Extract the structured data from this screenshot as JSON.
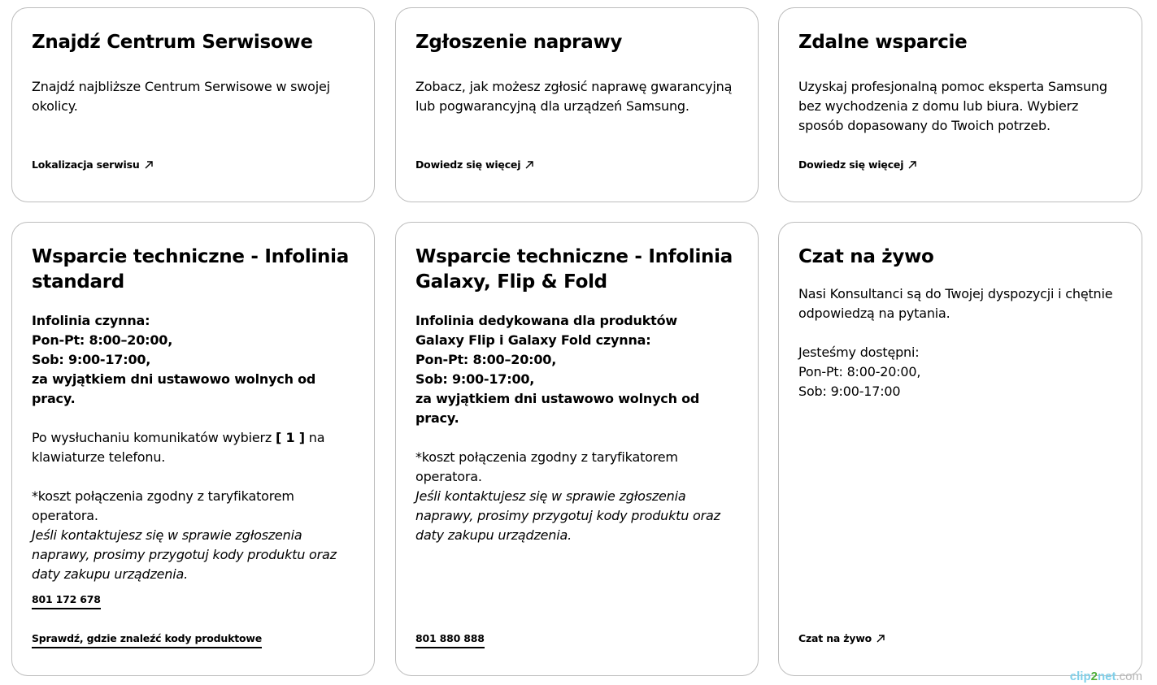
{
  "cards": {
    "service_center": {
      "title": "Znajdź Centrum Serwisowe",
      "desc": "Znajdź najbliższe Centrum Serwisowe w swojej okolicy.",
      "link": "Lokalizacja serwisu",
      "link_icon": "arrow-up-right-icon"
    },
    "repair": {
      "title": "Zgłoszenie naprawy",
      "desc": "Zobacz, jak możesz zgłosić naprawę gwarancyjną lub pogwarancyjną dla urządzeń Samsung.",
      "link": "Dowiedz się więcej",
      "link_icon": "arrow-up-right-icon"
    },
    "remote": {
      "title": "Zdalne wsparcie",
      "desc": "Uzyskaj profesjonalną pomoc eksperta Samsung bez wychodzenia z domu lub biura. Wybierz sposób dopasowany do Twoich potrzeb.",
      "link": "Dowiedz się więcej",
      "link_icon": "arrow-up-right-icon"
    },
    "hotline_standard": {
      "title": "Wsparcie techniczne - Infolinia standard",
      "hours": [
        "Infolinia czynna:",
        "Pon-Pt: 8:00–20:00,",
        "Sob: 9:00-17:00,",
        "za wyjątkiem dni ustawowo wolnych od pracy."
      ],
      "instruction_before": "Po wysłuchaniu komunikatów wybierz ",
      "instruction_key": "[ 1 ]",
      "instruction_after": " na klawiaturze telefonu.",
      "cost": "*koszt połączenia zgodny z taryfikatorem operatora.",
      "note": "Jeśli kontaktujesz się w sprawie zgłoszenia naprawy, prosimy przygotuj kody produktu oraz daty zakupu urządzenia.",
      "phone": "801 172 678",
      "codes_link": "Sprawdź, gdzie znaleźć kody produktowe"
    },
    "hotline_galaxy": {
      "title": "Wsparcie techniczne - Infolinia Galaxy, Flip & Fold",
      "hours": [
        "Infolinia dedykowana dla produktów",
        "Galaxy Flip i Galaxy Fold czynna:",
        "Pon-Pt: 8:00–20:00,",
        "Sob: 9:00-17:00,",
        "za wyjątkiem dni ustawowo wolnych od pracy."
      ],
      "cost": "*koszt połączenia zgodny z taryfikatorem operatora.",
      "note": "Jeśli kontaktujesz się w sprawie zgłoszenia naprawy, prosimy przygotuj kody produktu oraz daty zakupu urządzenia.",
      "phone": "801 880 888"
    },
    "live_chat": {
      "title": "Czat na żywo",
      "desc": "Nasi Konsultanci są do Twojej dyspozycji i chętnie odpowiedzą na pytania.",
      "availability": [
        "Jesteśmy dostępni:",
        "Pon-Pt: 8:00-20:00,",
        "Sob: 9:00-17:00"
      ],
      "link": "Czat na żywo",
      "link_icon": "arrow-up-right-icon"
    }
  },
  "watermark": {
    "part1": "clip",
    "part2": "2",
    "part3": "net",
    "part4": ".com"
  }
}
